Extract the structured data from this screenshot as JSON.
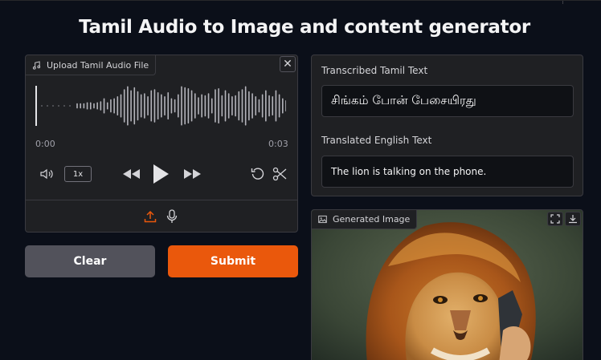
{
  "page": {
    "title": "Tamil Audio to Image and content generator"
  },
  "audio": {
    "label": "Upload Tamil Audio File",
    "time_start": "0:00",
    "time_end": "0:03",
    "speed": "1x",
    "waveform": [
      0.1,
      0.1,
      0.1,
      0.15,
      0.15,
      0.1,
      0.15,
      0.2,
      0.35,
      0.15,
      0.3,
      0.35,
      0.45,
      0.55,
      0.8,
      0.95,
      0.75,
      0.9,
      0.7,
      0.55,
      0.6,
      0.45,
      0.75,
      0.8,
      0.65,
      0.55,
      0.45,
      0.65,
      0.35,
      0.3,
      0.55,
      0.95,
      0.9,
      0.85,
      0.75,
      0.6,
      0.4,
      0.55,
      0.5,
      0.6,
      0.35,
      0.8,
      0.85,
      0.5,
      0.75,
      0.6,
      0.45,
      0.5,
      0.7,
      0.8,
      0.95,
      0.7,
      0.6,
      0.45,
      0.3,
      0.55,
      0.75,
      0.5,
      0.45,
      0.75,
      0.55,
      0.35,
      0.25
    ]
  },
  "buttons": {
    "clear": "Clear",
    "submit": "Submit"
  },
  "transcription": {
    "tamil_label": "Transcribed Tamil Text",
    "tamil_value": "சிங்கம் போன் பேசையிரது",
    "english_label": "Translated English Text",
    "english_value": "The lion is talking on the phone."
  },
  "image": {
    "label": "Generated Image"
  },
  "colors": {
    "accent": "#ea580c",
    "background": "#0b0f19",
    "panel": "#1f2023"
  }
}
